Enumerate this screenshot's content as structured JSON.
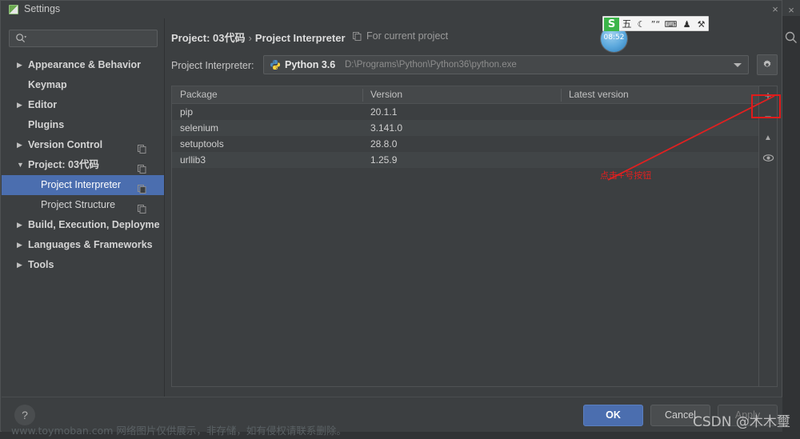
{
  "window": {
    "title": "Settings",
    "title_icon": "settings-app-icon",
    "dialog_close": "×",
    "ide_close": "×",
    "ide_search_icon": "search-icon"
  },
  "sidebar": {
    "search": {
      "placeholder": "",
      "value": "",
      "icon": "search-icon"
    },
    "items": [
      {
        "label": "Appearance & Behavior",
        "arrow": "▶",
        "indent": 33,
        "bold": true,
        "selected": false,
        "copy_icon": false
      },
      {
        "label": "Keymap",
        "arrow": "",
        "indent": 33,
        "bold": true,
        "selected": false,
        "copy_icon": false
      },
      {
        "label": "Editor",
        "arrow": "▶",
        "indent": 33,
        "bold": true,
        "selected": false,
        "copy_icon": false
      },
      {
        "label": "Plugins",
        "arrow": "",
        "indent": 33,
        "bold": true,
        "selected": false,
        "copy_icon": false
      },
      {
        "label": "Version Control",
        "arrow": "▶",
        "indent": 33,
        "bold": true,
        "selected": false,
        "copy_icon": true
      },
      {
        "label": "Project: 03代码",
        "arrow": "▼",
        "indent": 33,
        "bold": true,
        "selected": false,
        "copy_icon": true
      },
      {
        "label": "Project Interpreter",
        "arrow": "",
        "indent": 49,
        "bold": false,
        "selected": true,
        "copy_icon": true
      },
      {
        "label": "Project Structure",
        "arrow": "",
        "indent": 49,
        "bold": false,
        "selected": false,
        "copy_icon": true
      },
      {
        "label": "Build, Execution, Deployme",
        "arrow": "▶",
        "indent": 33,
        "bold": true,
        "selected": false,
        "copy_icon": false
      },
      {
        "label": "Languages & Frameworks",
        "arrow": "▶",
        "indent": 33,
        "bold": true,
        "selected": false,
        "copy_icon": false
      },
      {
        "label": "Tools",
        "arrow": "▶",
        "indent": 33,
        "bold": true,
        "selected": false,
        "copy_icon": false
      }
    ]
  },
  "pane": {
    "breadcrumb_project": "Project: 03代码",
    "breadcrumb_sep": "›",
    "breadcrumb_page": "Project Interpreter",
    "for_current_project": "For current project",
    "for_current_project_icon": "copy-icon",
    "interpreter_label": "Project Interpreter:",
    "interpreter_name": "Python 3.6",
    "interpreter_path": "D:\\Programs\\Python\\Python36\\python.exe",
    "interpreter_icon": "python-icon",
    "combo_arrow_icon": "chevron-down-icon",
    "gear_icon": "gear-icon"
  },
  "table": {
    "columns": [
      "Package",
      "Version",
      "Latest version"
    ],
    "rows": [
      {
        "package": "pip",
        "version": "20.1.1",
        "latest": ""
      },
      {
        "package": "selenium",
        "version": "3.141.0",
        "latest": ""
      },
      {
        "package": "setuptools",
        "version": "28.8.0",
        "latest": ""
      },
      {
        "package": "urllib3",
        "version": "1.25.9",
        "latest": ""
      }
    ],
    "toolbar": [
      {
        "name": "add-package-button",
        "glyph": "+",
        "highlighted": true
      },
      {
        "name": "remove-package-button",
        "glyph": "−",
        "highlighted": false
      },
      {
        "name": "upgrade-package-button",
        "glyph": "▲",
        "highlighted": false
      },
      {
        "name": "show-early-releases-button",
        "glyph": "◉",
        "highlighted": false
      }
    ]
  },
  "annotation": {
    "text": "点击+号按钮",
    "color": "#e02020"
  },
  "footer": {
    "help_label": "?",
    "ok_label": "OK",
    "cancel_label": "Cancel",
    "apply_label": "Apply"
  },
  "ime": {
    "logo": "S",
    "items": [
      "五",
      "☾",
      "”“",
      "⌨",
      "♟",
      "⚒"
    ],
    "clock_time": "08:52"
  },
  "watermarks": {
    "toymoban": "www.toymoban.com 网络图片仅供展示，非存储，如有侵权请联系删除。",
    "csdn": "CSDN @木木璽"
  },
  "colors": {
    "accent": "#4b6eaf",
    "annotation_red": "#e02020",
    "panel_bg": "#3c3f41"
  }
}
